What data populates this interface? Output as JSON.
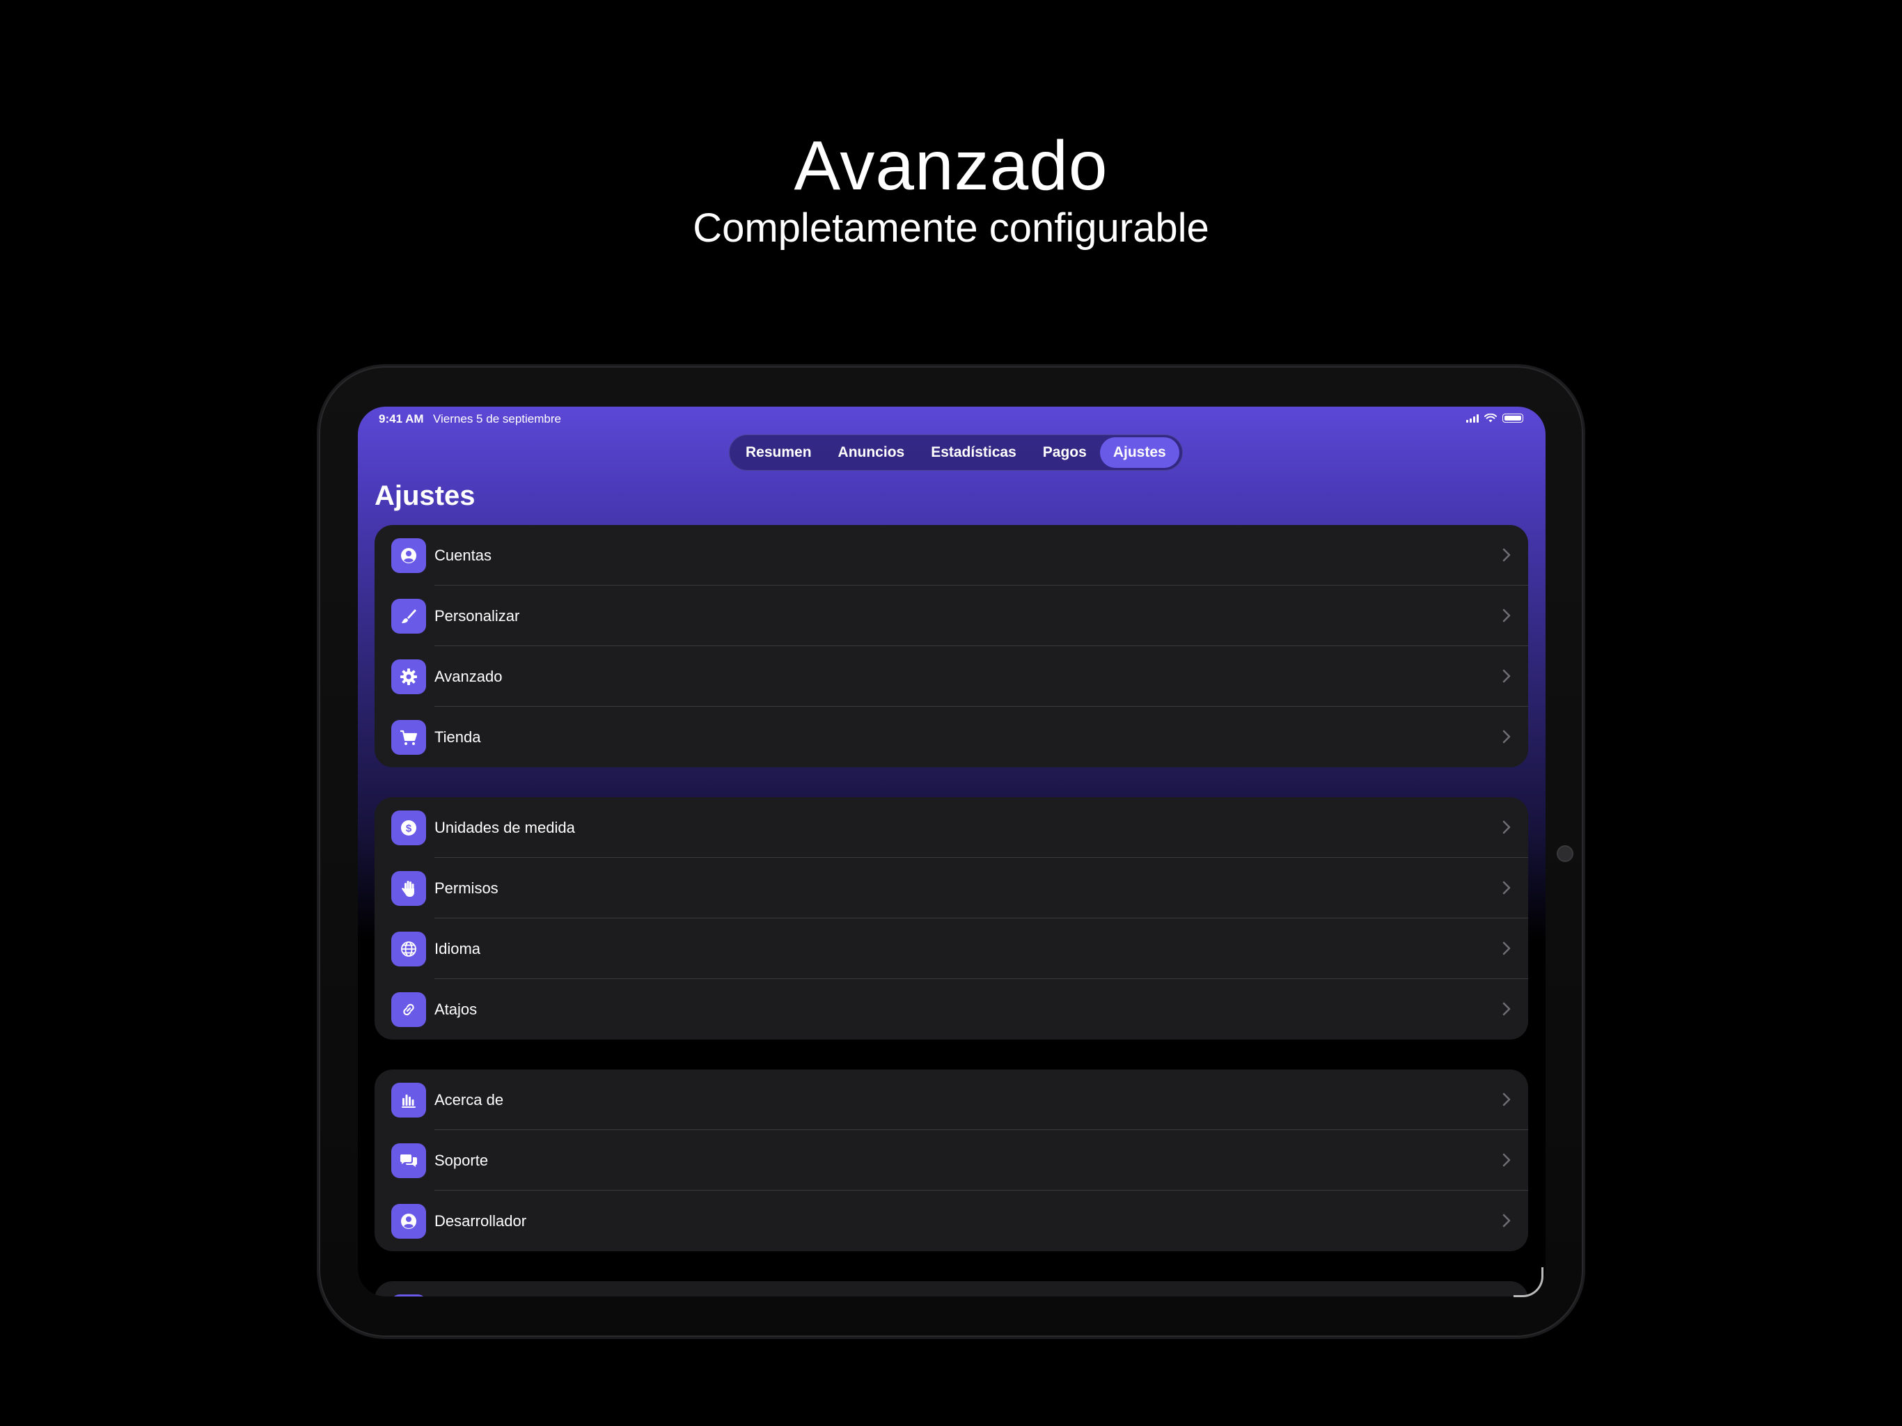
{
  "hero": {
    "title": "Avanzado",
    "subtitle": "Completamente configurable"
  },
  "status_bar": {
    "time": "9:41 AM",
    "date": "Viernes 5 de septiembre"
  },
  "tabs": [
    {
      "label": "Resumen",
      "active": false
    },
    {
      "label": "Anuncios",
      "active": false
    },
    {
      "label": "Estadísticas",
      "active": false
    },
    {
      "label": "Pagos",
      "active": false
    },
    {
      "label": "Ajustes",
      "active": true
    }
  ],
  "page": {
    "title": "Ajustes"
  },
  "groups": [
    {
      "items": [
        {
          "label": "Cuentas",
          "icon": "person-circle-icon"
        },
        {
          "label": "Personalizar",
          "icon": "paintbrush-icon"
        },
        {
          "label": "Avanzado",
          "icon": "gear-icon"
        },
        {
          "label": "Tienda",
          "icon": "cart-icon"
        }
      ]
    },
    {
      "items": [
        {
          "label": "Unidades de medida",
          "icon": "dollar-circle-icon"
        },
        {
          "label": "Permisos",
          "icon": "hand-icon"
        },
        {
          "label": "Idioma",
          "icon": "globe-icon"
        },
        {
          "label": "Atajos",
          "icon": "link-icon"
        }
      ]
    },
    {
      "items": [
        {
          "label": "Acerca de",
          "icon": "chart-bars-icon"
        },
        {
          "label": "Soporte",
          "icon": "chat-bubbles-icon"
        },
        {
          "label": "Desarrollador",
          "icon": "person-circle-icon"
        }
      ]
    }
  ],
  "colors": {
    "accent": "#6a5ae8",
    "row_background": "#1c1c1e",
    "gradient_top": "#5b48d6"
  }
}
